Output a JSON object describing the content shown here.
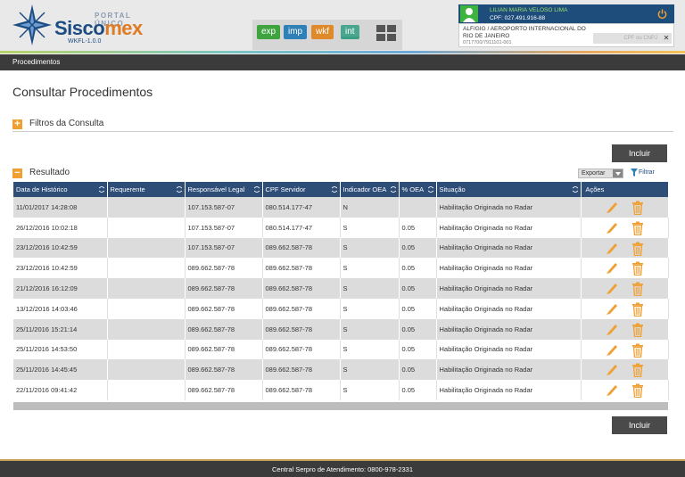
{
  "header": {
    "logo_portal": "PORTAL ÚNICO",
    "logo_sisco": "Sisco",
    "logo_ex": "mex",
    "version": "WKFL-1.0.0",
    "modules": [
      {
        "label": "exp",
        "color": "#3fa33f"
      },
      {
        "label": "imp",
        "color": "#2f80b7"
      },
      {
        "label": "wkf",
        "color": "#e0892a"
      },
      {
        "label": "int",
        "color": "#4aa68f"
      }
    ],
    "user": {
      "name": "LILIAN MARIA VELOSO LIMA",
      "cpf": "CPF: 027.491.916-88",
      "unit": "ALF/GIG / AEROPORTO INTERNACIONAL DO RIO DE JANEIRO",
      "code": "0717700/7911101-001",
      "cnpj_placeholder": "CPF ou CNPJ"
    }
  },
  "nav": {
    "breadcrumb": "Procedimentos"
  },
  "main": {
    "title": "Consultar Procedimentos",
    "filters_label": "Filtros da Consulta",
    "results_label": "Resultado",
    "include_label": "Incluir",
    "export_label": "Exportar",
    "filter_label": "Filtrar"
  },
  "table": {
    "columns": [
      "Data de Histórico",
      "Requerente",
      "Responsável Legal",
      "CPF Servidor",
      "Indicador OEA",
      "% OEA",
      "Situação",
      "Ações"
    ],
    "rows": [
      [
        "11/01/2017 14:28:08",
        "",
        "107.153.587-07",
        "080.514.177-47",
        "N",
        "",
        "Habilitação Originada no Radar"
      ],
      [
        "26/12/2016 10:02:18",
        "",
        "107.153.587-07",
        "080.514.177-47",
        "S",
        "0.05",
        "Habilitação Originada no Radar"
      ],
      [
        "23/12/2016 10:42:59",
        "",
        "107.153.587-07",
        "089.662.587-78",
        "S",
        "0.05",
        "Habilitação Originada no Radar"
      ],
      [
        "23/12/2016 10:42:59",
        "",
        "089.662.587-78",
        "089.662.587-78",
        "S",
        "0.05",
        "Habilitação Originada no Radar"
      ],
      [
        "21/12/2016 16:12:09",
        "",
        "089.662.587-78",
        "089.662.587-78",
        "S",
        "0.05",
        "Habilitação Originada no Radar"
      ],
      [
        "13/12/2016 14:03:46",
        "",
        "089.662.587-78",
        "089.662.587-78",
        "S",
        "0.05",
        "Habilitação Originada no Radar"
      ],
      [
        "25/11/2016 15:21:14",
        "",
        "089.662.587-78",
        "089.662.587-78",
        "S",
        "0.05",
        "Habilitação Originada no Radar"
      ],
      [
        "25/11/2016 14:53:50",
        "",
        "089.662.587-78",
        "089.662.587-78",
        "S",
        "0.05",
        "Habilitação Originada no Radar"
      ],
      [
        "25/11/2016 14:45:45",
        "",
        "089.662.587-78",
        "089.662.587-78",
        "S",
        "0.05",
        "Habilitação Originada no Radar"
      ],
      [
        "22/11/2016 09:41:42",
        "",
        "089.662.587-78",
        "089.662.587-78",
        "S",
        "0.05",
        "Habilitação Originada no Radar"
      ]
    ],
    "row_actions": {
      "edit_icon": "pencil-icon",
      "delete_icon": "trash-icon",
      "edit_color": "#f0a032",
      "delete_color": "#f0a032"
    }
  },
  "footer": {
    "text": "Central Serpro de Atendimento: 0800-978-2331"
  },
  "colors": {
    "header_blue": "#2e4e78",
    "accent_orange": "#f0a032",
    "dark_bar": "#3b3b3b"
  }
}
